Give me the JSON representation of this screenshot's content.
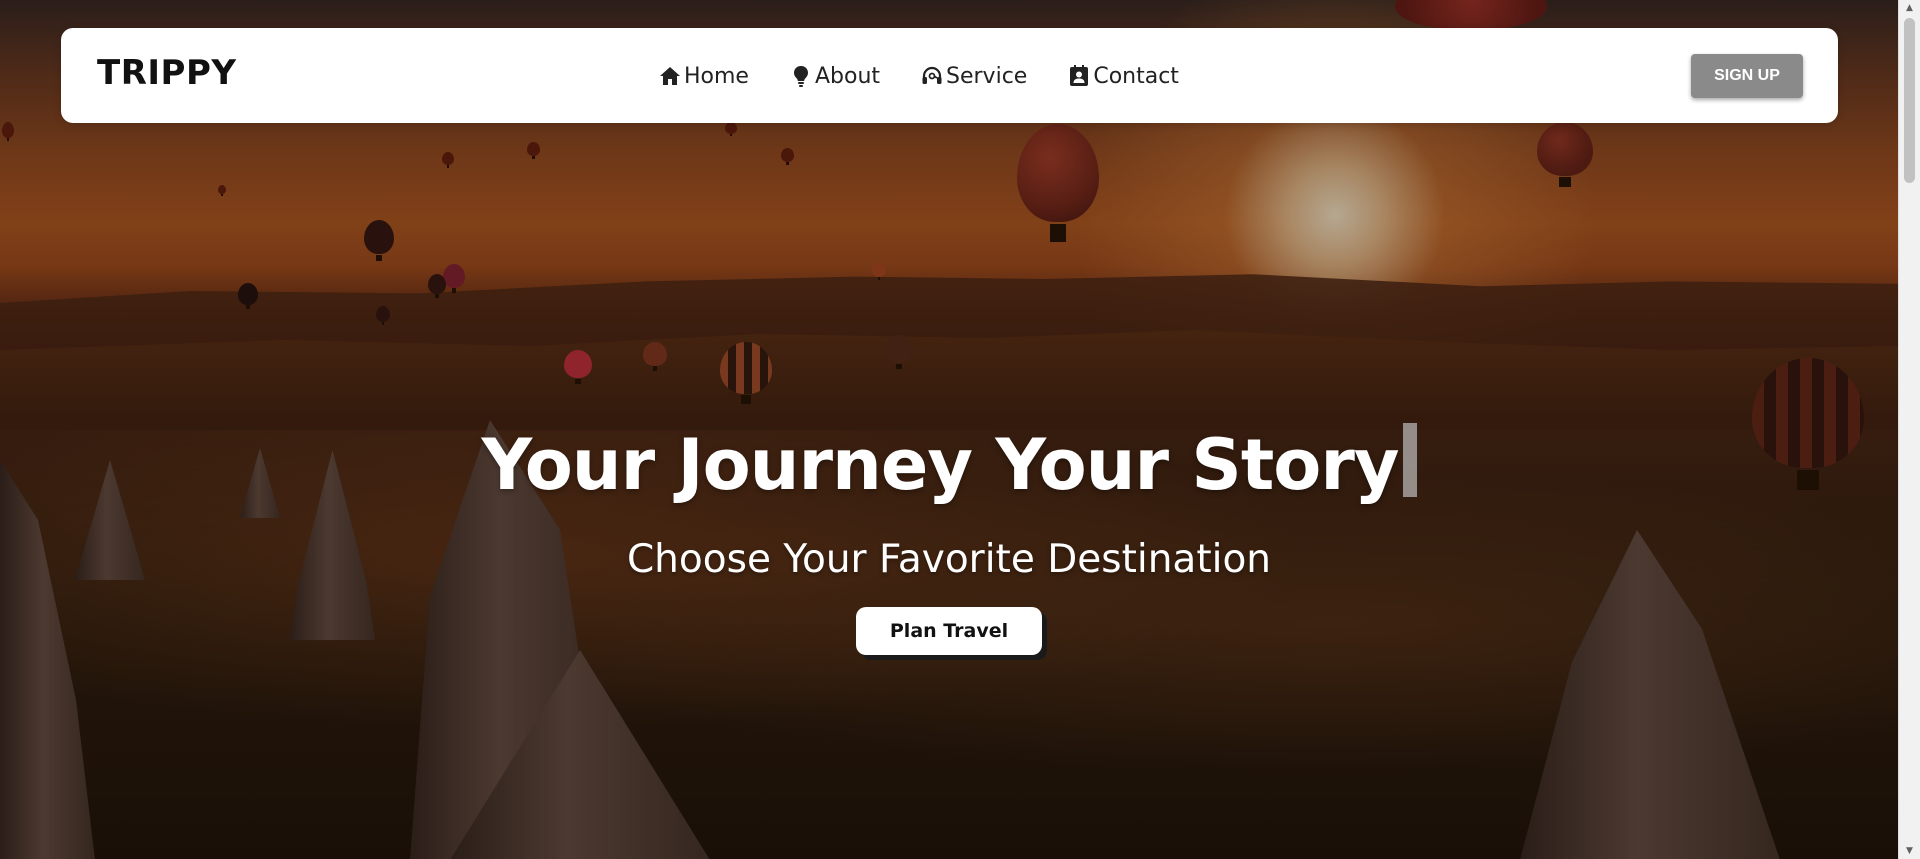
{
  "navbar": {
    "brand": "TRIPPY",
    "links": [
      {
        "label": "Home",
        "icon": "home-icon"
      },
      {
        "label": "About",
        "icon": "lightbulb-icon"
      },
      {
        "label": "Service",
        "icon": "headset-icon"
      },
      {
        "label": "Contact",
        "icon": "contact-card-icon"
      }
    ],
    "signup_label": "SIGN UP"
  },
  "hero": {
    "headline": "Your Journey Your Story",
    "subheadline": "Choose Your Favorite Destination",
    "cta_label": "Plan Travel"
  },
  "colors": {
    "navbar_bg": "#ffffff",
    "signup_bg": "#8a8a8a",
    "hero_text": "#ffffff",
    "cta_bg": "#ffffff"
  }
}
